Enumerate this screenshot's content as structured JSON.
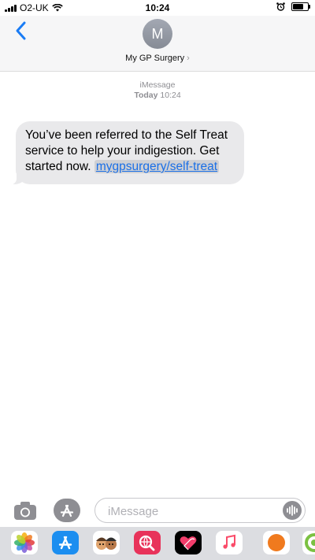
{
  "status_bar": {
    "carrier": "O2-UK",
    "time": "10:24",
    "battery_percent": 70
  },
  "header": {
    "avatar_initial": "M",
    "contact_name": "My GP Surgery",
    "chevron": "›"
  },
  "thread": {
    "service": "iMessage",
    "day": "Today",
    "timestamp": "10:24",
    "message_text": "You’ve been referred to the Self Treat service to help your indigestion. Get started now. ",
    "message_link": "mygpsurgery/self-treat"
  },
  "compose": {
    "placeholder": "iMessage"
  },
  "app_drawer": {
    "apps": [
      "photos-icon",
      "app-store-icon",
      "memoji-icon",
      "web-search-icon",
      "digital-touch-icon",
      "music-icon",
      "orange-app-icon",
      "green-app-icon"
    ]
  },
  "colors": {
    "link": "#1a6fe6",
    "bubble": "#e9e9eb",
    "back_chevron": "#1a7cf5"
  }
}
